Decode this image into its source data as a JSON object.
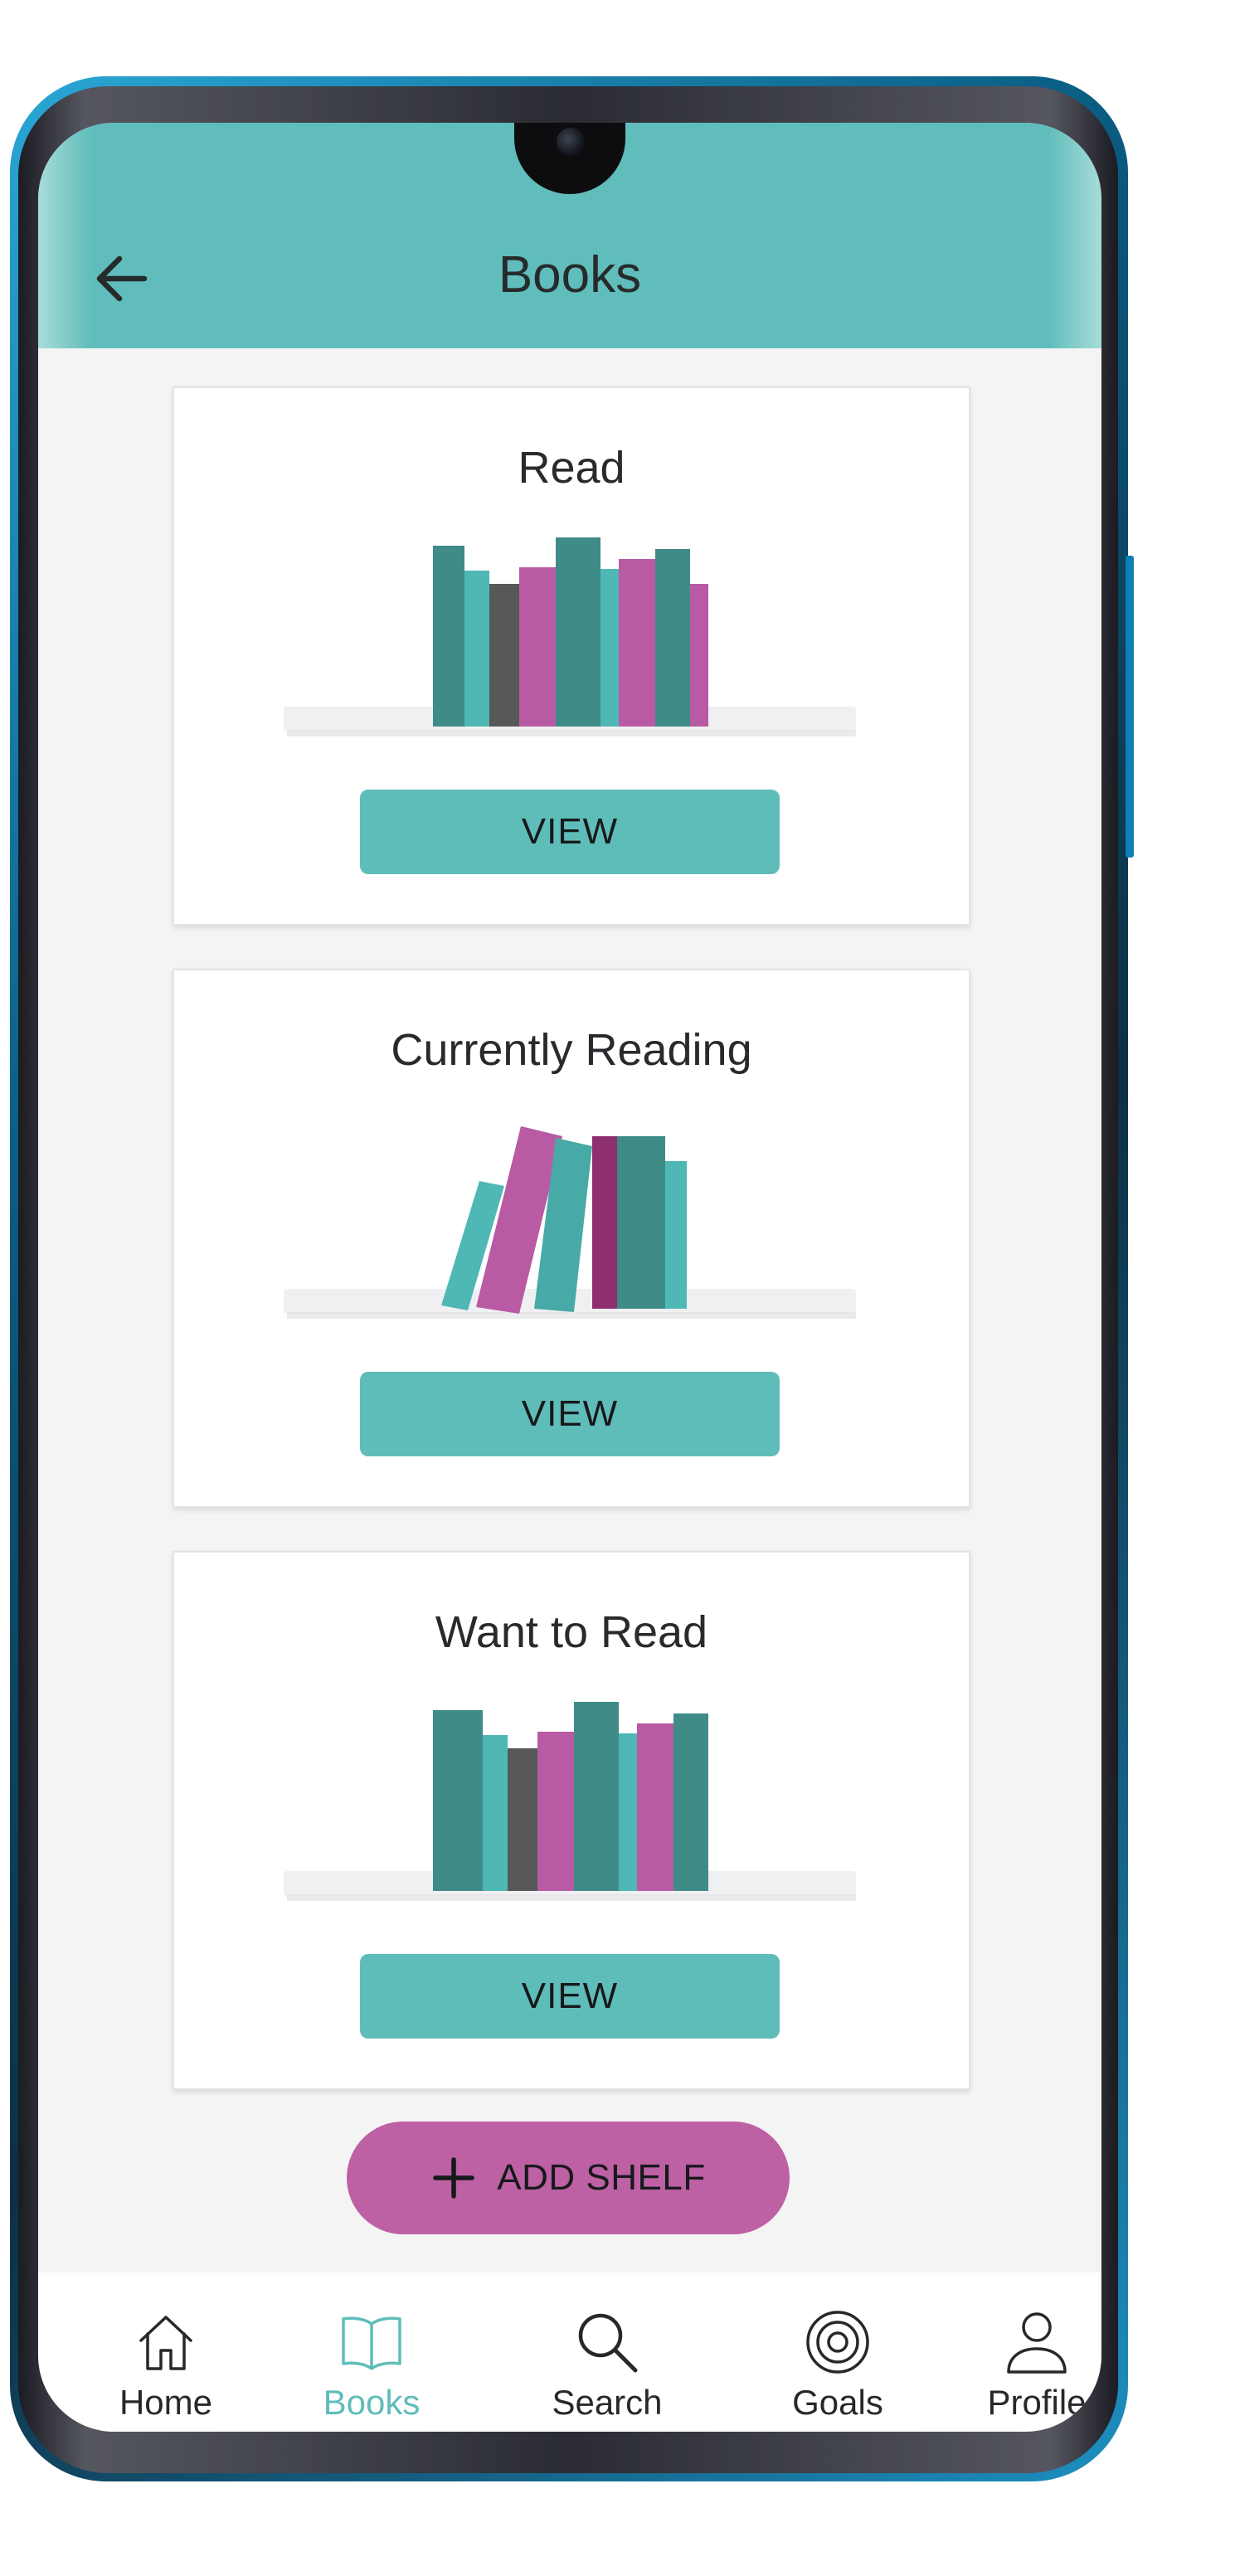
{
  "header": {
    "title": "Books",
    "back_icon": "arrow-left-icon",
    "background_color": "#60bdbb"
  },
  "shelves": [
    {
      "title": "Read",
      "button_label": "VIEW"
    },
    {
      "title": "Currently Reading",
      "button_label": "VIEW"
    },
    {
      "title": "Want to Read",
      "button_label": "VIEW"
    }
  ],
  "add_shelf": {
    "label": "ADD SHELF",
    "icon": "plus-icon",
    "color": "#bd60a4"
  },
  "bottom_nav": {
    "active_color": "#5fbdb9",
    "items": [
      {
        "label": "Home",
        "icon": "home-icon",
        "active": false
      },
      {
        "label": "Books",
        "icon": "book-icon",
        "active": true
      },
      {
        "label": "Search",
        "icon": "search-icon",
        "active": false
      },
      {
        "label": "Goals",
        "icon": "target-icon",
        "active": false
      },
      {
        "label": "Profile",
        "icon": "user-icon",
        "active": false
      }
    ]
  },
  "colors": {
    "teal_button": "#5fbdb9",
    "book_magenta": "#b95aa4",
    "book_teal_dark": "#3f8b87",
    "book_gray": "#585858"
  }
}
